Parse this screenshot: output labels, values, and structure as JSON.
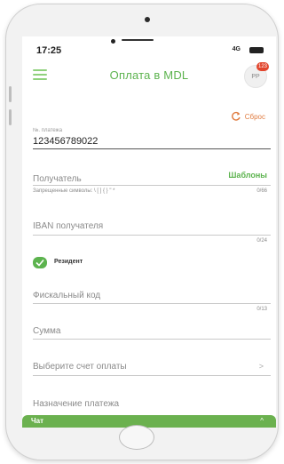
{
  "status_bar": {
    "time": "17:25",
    "signal": "4G"
  },
  "header": {
    "title": "Оплата в MDL",
    "avatar_initials": "PP",
    "badge": "123"
  },
  "reset": {
    "label": "Сброс"
  },
  "form": {
    "payment_number": {
      "label": "№. платежа",
      "value": "123456789022"
    },
    "recipient": {
      "label": "Получатель",
      "templates_label": "Шаблоны",
      "hint": "Запрещенные символы: \\ [ ] { } \" *",
      "counter": "0/66"
    },
    "iban": {
      "label": "IBAN получателя",
      "counter": "0/24"
    },
    "resident": {
      "label": "Резидент",
      "checked": true
    },
    "fiscal_code": {
      "label": "Фискальный код",
      "counter": "0/13"
    },
    "amount": {
      "label": "Сумма"
    },
    "account": {
      "label": "Выберите счет оплаты"
    },
    "purpose": {
      "label": "Назначение платежа"
    }
  },
  "chat": {
    "label": "Чат"
  },
  "colors": {
    "accent_green": "#5cb34e",
    "reset_orange": "#e07b3f",
    "badge_red": "#e2462d"
  },
  "icons": {
    "menu": "hamburger-icon",
    "reset": "refresh-icon",
    "check": "check-icon",
    "account_chevron": "chevron-right-icon",
    "chat_chevron": "chevron-up-icon"
  }
}
